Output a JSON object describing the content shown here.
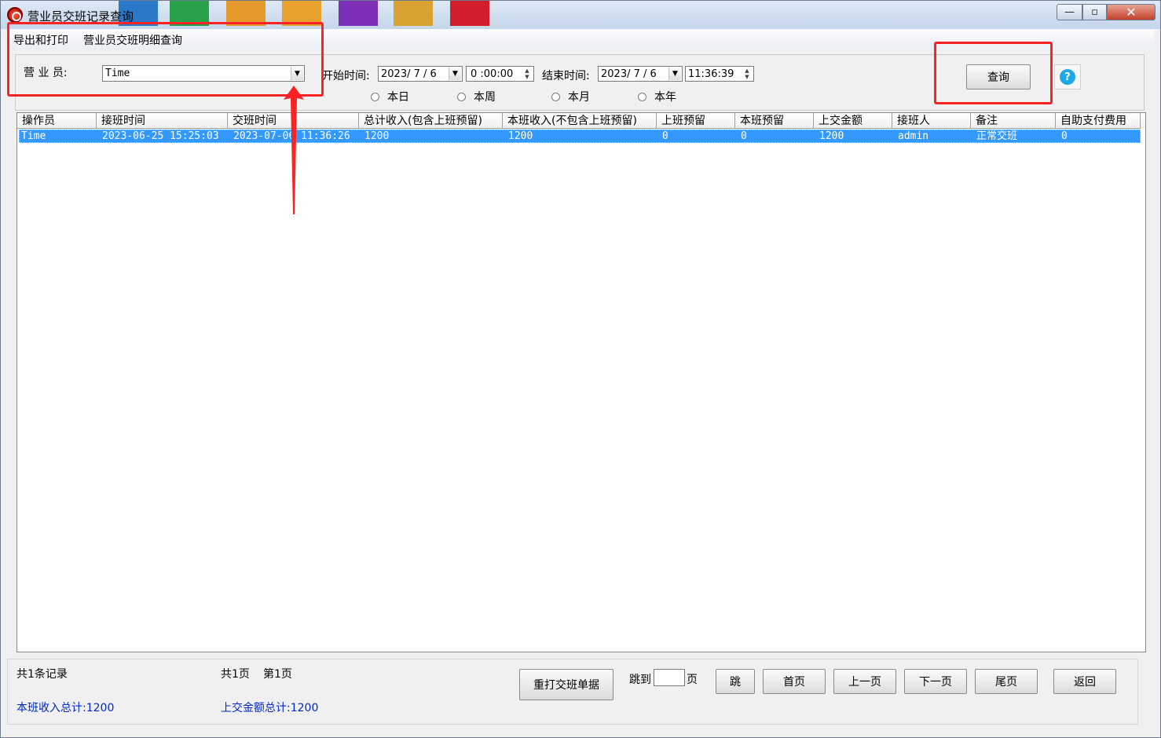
{
  "window": {
    "title": "营业员交班记录查询",
    "controls": {
      "minimize": "—",
      "maximize": "▫",
      "close": "✕"
    }
  },
  "menu": {
    "items": [
      "导出和打印",
      "营业员交班明细查询"
    ]
  },
  "filter": {
    "clerk_label": "营 业 员:",
    "clerk_value": "Time",
    "start_label": "开始时间:",
    "start_date": "2023/ 7 / 6",
    "start_time": "0 :00:00",
    "end_label": "结束时间:",
    "end_date": "2023/ 7 / 6",
    "end_time": "11:36:39",
    "periods": [
      "本日",
      "本周",
      "本月",
      "本年"
    ],
    "query_button": "查询",
    "help_symbol": "?"
  },
  "grid": {
    "columns": [
      "操作员",
      "接班时间",
      "交班时间",
      "总计收入(包含上班预留)",
      "本班收入(不包含上班预留)",
      "上班预留",
      "本班预留",
      "上交金额",
      "接班人",
      "备注",
      "自助支付费用"
    ],
    "rows": [
      [
        "Time",
        "2023-06-25 15:25:03",
        "2023-07-06 11:36:26",
        "1200",
        "1200",
        "0",
        "0",
        "1200",
        "admin",
        "正常交班",
        "0"
      ]
    ]
  },
  "footer": {
    "record_count": "共1条记录",
    "page_total": "共1页",
    "page_current": "第1页",
    "shift_income_total": "本班收入总计:1200",
    "handover_total": "上交金额总计:1200",
    "reprint_button": "重打交班单据",
    "jump_label": "跳到",
    "jump_unit": "页",
    "jump_button": "跳",
    "first_button": "首页",
    "prev_button": "上一页",
    "next_button": "下一页",
    "last_button": "尾页",
    "back_button": "返回"
  },
  "colors": {
    "selection": "#3399ff",
    "annotation": "#ff2222",
    "summary_text": "#0028c8",
    "help_icon": "#1fa8e6"
  }
}
